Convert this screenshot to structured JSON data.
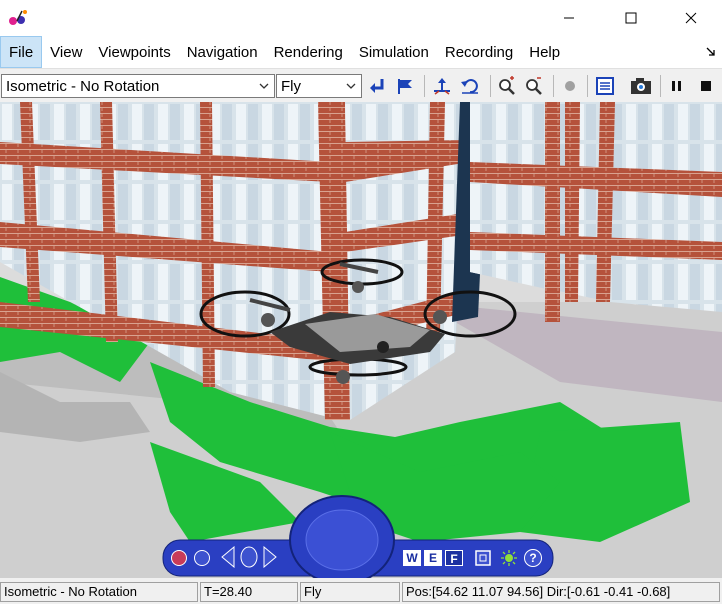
{
  "window": {
    "minimize_icon": "minimize-icon",
    "maximize_icon": "maximize-icon",
    "close_icon": "close-icon"
  },
  "menu": {
    "items": [
      "File",
      "View",
      "Viewpoints",
      "Navigation",
      "Rendering",
      "Simulation",
      "Recording",
      "Help"
    ],
    "active_index": 0
  },
  "toolbar": {
    "viewpoint_value": "Isometric - No Rotation",
    "navigation_value": "Fly",
    "buttons": [
      "return-icon",
      "flag-icon",
      "straighten-up-icon",
      "undo-move-icon",
      "zoom-in-icon",
      "zoom-out-icon",
      "record-icon",
      "notes-icon",
      "camera-icon",
      "pause-icon",
      "stop-icon"
    ]
  },
  "navpanel": {
    "walk_letter": "W",
    "examine_letter": "E",
    "fly_letter": "F",
    "help_symbol": "?"
  },
  "status": {
    "viewpoint": "Isometric - No Rotation",
    "time": "T=28.40",
    "mode": "Fly",
    "position": "Pos:[54.62 11.07 94.56] Dir:[-0.61 -0.41 -0.68]"
  },
  "colors": {
    "accent_blue": "#1b43b8",
    "brick": "#b5523b",
    "grass": "#1fbf3a",
    "nav_panel": "#2a3fc2"
  }
}
